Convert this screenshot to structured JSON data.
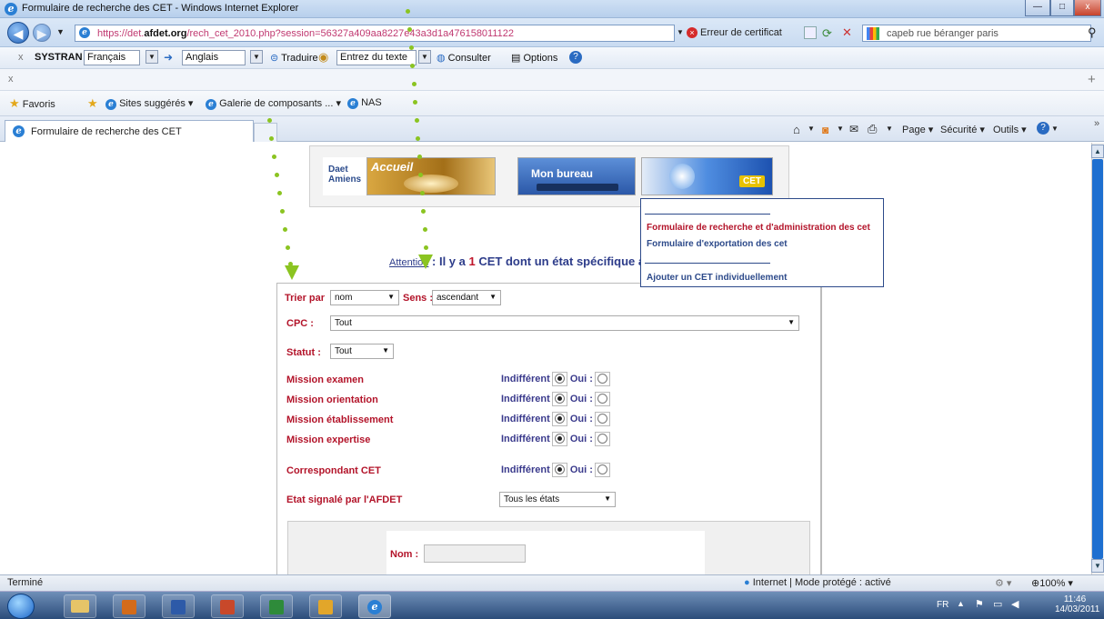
{
  "window": {
    "title": "Formulaire de recherche des CET - Windows Internet Explorer",
    "minimize": "—",
    "maximize": "□",
    "close": "x"
  },
  "address": {
    "url_prefix": "https://det.",
    "url_domain": "afdet.org",
    "url_rest": "/rech_cet_2010.php?session=56327a409aa8227e43a3d1a476158011122",
    "cert_error": "Erreur de certificat",
    "search_value": "capeb rue béranger paris"
  },
  "systran": {
    "close": "x",
    "brand": "SYSTRAN",
    "source_lang": "Français",
    "target_lang": "Anglais",
    "translate": "Traduire",
    "input_placeholder": "Entrez du texte",
    "consult": "Consulter",
    "options": "Options"
  },
  "toolbar2": {
    "close": "x",
    "add": "+"
  },
  "favorites": {
    "label": "Favoris",
    "suggested": "Sites suggérés ▾",
    "gallery": "Galerie de composants ... ▾",
    "nas": "NAS"
  },
  "tab": {
    "title": "Formulaire de recherche des CET"
  },
  "commandbar": {
    "page": "Page ▾",
    "security": "Sécurité ▾",
    "tools": "Outils ▾",
    "more": "»"
  },
  "banner": {
    "logo_line1": "Daet",
    "logo_line2": "Amiens",
    "accueil": "Accueil",
    "bureau": "Mon bureau",
    "cet": "CET"
  },
  "menu": {
    "item1": "Formulaire de recherche et d'administration des cet",
    "item2": "Formulaire d'exportation des cet",
    "item3": "Ajouter un CET individuellement"
  },
  "attention": {
    "link": "Attention",
    "text1": " : Il y a ",
    "count": "1",
    "text2": " CET dont un état spécifique a"
  },
  "form": {
    "sort_label": "Trier par",
    "sort_value": "nom",
    "order_label": "Sens :",
    "order_value": "ascendant",
    "cpc_label": "CPC :",
    "cpc_value": "Tout",
    "status_label": "Statut :",
    "status_value": "Tout",
    "missions": [
      {
        "label": "Mission examen"
      },
      {
        "label": "Mission orientation"
      },
      {
        "label": "Mission établissement"
      },
      {
        "label": "Mission expertise"
      }
    ],
    "correspondant": "Correspondant CET",
    "indifferent": "Indifférent",
    "oui": "Oui :",
    "etat_label": "Etat signalé par l'AFDET",
    "etat_value": "Tous les états",
    "nom_label": "Nom :"
  },
  "statusbar": {
    "left": "Terminé",
    "zone": "Internet | Mode protégé : activé",
    "zoom": "100%"
  },
  "taskbar": {
    "lang": "FR",
    "time": "11:46",
    "date": "14/03/2011"
  },
  "colors": {
    "label_red": "#b3142a",
    "label_blue": "#3a3a8c",
    "accent_green": "#8bc421"
  }
}
